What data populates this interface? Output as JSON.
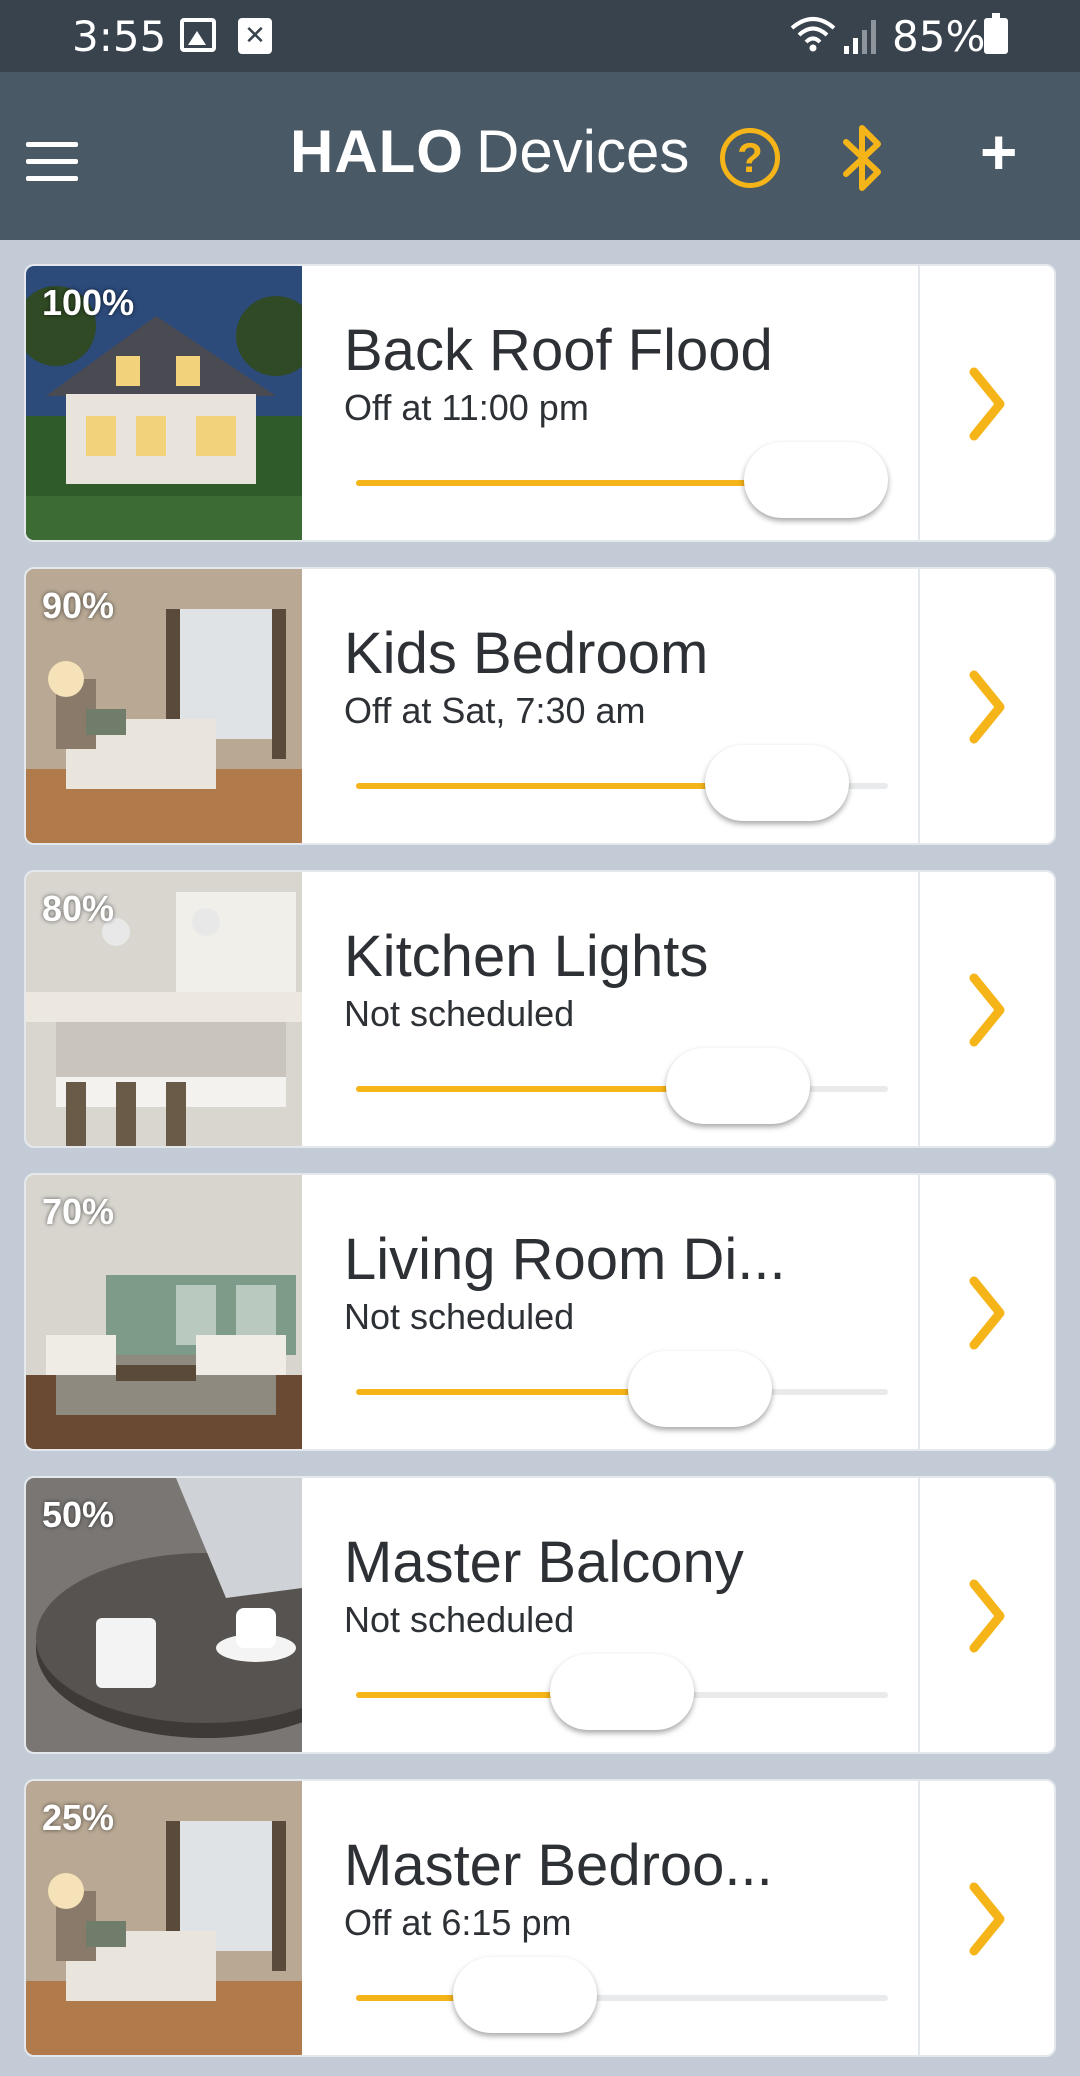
{
  "status_bar": {
    "time": "3:55",
    "battery": "85%"
  },
  "app_bar": {
    "brand": "HALO",
    "title": "Devices",
    "help_symbol": "?",
    "add_symbol": "+"
  },
  "colors": {
    "accent": "#f5b418",
    "app_bar": "#4a5966",
    "status_bar": "#39434d",
    "background": "#c3ccd6"
  },
  "devices": [
    {
      "name": "Back Roof Flood",
      "schedule": "Off at 11:00 pm",
      "percent_label": "100%",
      "level": 1.0,
      "image": "house-exterior-night"
    },
    {
      "name": "Kids Bedroom",
      "schedule": "Off at Sat, 7:30 am",
      "percent_label": "90%",
      "level": 0.9,
      "image": "bedroom"
    },
    {
      "name": "Kitchen Lights",
      "schedule": "Not scheduled",
      "percent_label": "80%",
      "level": 0.8,
      "image": "kitchen"
    },
    {
      "name": "Living Room Di...",
      "schedule": "Not scheduled",
      "percent_label": "70%",
      "level": 0.7,
      "image": "living-room"
    },
    {
      "name": "Master Balcony",
      "schedule": "Not scheduled",
      "percent_label": "50%",
      "level": 0.5,
      "image": "coffee-table"
    },
    {
      "name": "Master Bedroo...",
      "schedule": "Off at 6:15 pm",
      "percent_label": "25%",
      "level": 0.25,
      "image": "bedroom"
    }
  ]
}
